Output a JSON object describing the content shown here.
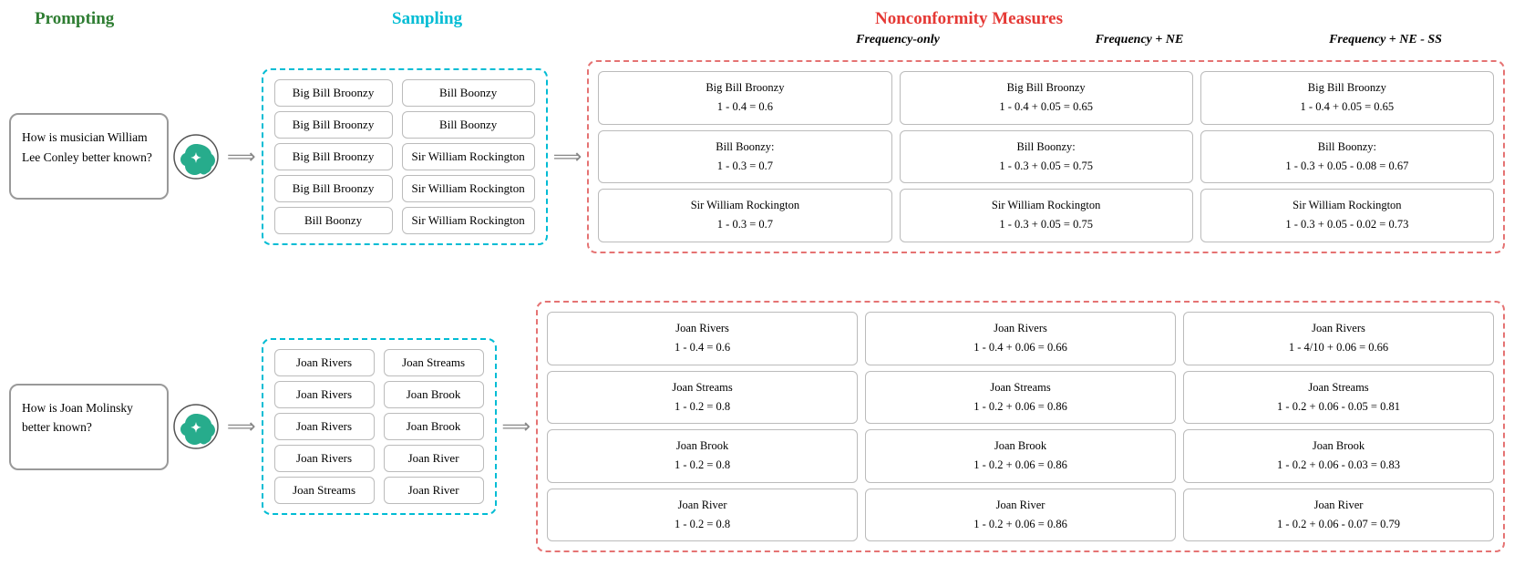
{
  "headers": {
    "prompting": "Prompting",
    "sampling": "Sampling",
    "nonconformity": "Nonconformity Measures",
    "freq_only": "Frequency-only",
    "freq_ne": "Frequency + NE",
    "freq_ne_ss": "Frequency + NE - SS"
  },
  "rows": [
    {
      "prompt": "How is musician William Lee Conley better known?",
      "samples_left": [
        "Big Bill Broonzy",
        "Big Bill Broonzy",
        "Big Bill Broonzy",
        "Big Bill Broonzy",
        "Bill Boonzy"
      ],
      "samples_right": [
        "Bill Boonzy",
        "Bill Boonzy",
        "Sir William Rockington",
        "Sir William Rockington",
        "Sir William Rockington"
      ],
      "nc_freq": [
        {
          "name": "Big Bill Broonzy",
          "formula": "1 - 0.4 = 0.6"
        },
        {
          "name": "Bill Boonzy:",
          "formula": "1 - 0.3 = 0.7"
        },
        {
          "name": "Sir William Rockington",
          "formula": "1 - 0.3 = 0.7"
        }
      ],
      "nc_freq_ne": [
        {
          "name": "Big Bill Broonzy",
          "formula": "1 - 0.4 + 0.05 = 0.65"
        },
        {
          "name": "Bill Boonzy:",
          "formula": "1 - 0.3 + 0.05 = 0.75"
        },
        {
          "name": "Sir William Rockington",
          "formula": "1 - 0.3 + 0.05 = 0.75"
        }
      ],
      "nc_freq_ne_ss": [
        {
          "name": "Big Bill Broonzy",
          "formula": "1 - 0.4 + 0.05 = 0.65"
        },
        {
          "name": "Bill Boonzy:",
          "formula": "1 - 0.3 + 0.05 - 0.08 = 0.67"
        },
        {
          "name": "Sir William Rockington",
          "formula": "1 - 0.3 + 0.05 - 0.02 = 0.73"
        }
      ]
    },
    {
      "prompt": "How is Joan Molinsky better known?",
      "samples_left": [
        "Joan Rivers",
        "Joan Rivers",
        "Joan Rivers",
        "Joan Rivers",
        "Joan Streams"
      ],
      "samples_right": [
        "Joan Streams",
        "Joan Brook",
        "Joan Brook",
        "Joan River",
        "Joan River"
      ],
      "nc_freq": [
        {
          "name": "Joan Rivers",
          "formula": "1 - 0.4 = 0.6"
        },
        {
          "name": "Joan Streams",
          "formula": "1 - 0.2 = 0.8"
        },
        {
          "name": "Joan Brook",
          "formula": "1 - 0.2 = 0.8"
        },
        {
          "name": "Joan River",
          "formula": "1 - 0.2 = 0.8"
        }
      ],
      "nc_freq_ne": [
        {
          "name": "Joan Rivers",
          "formula": "1 - 0.4 + 0.06 = 0.66"
        },
        {
          "name": "Joan Streams",
          "formula": "1 - 0.2 + 0.06 = 0.86"
        },
        {
          "name": "Joan Brook",
          "formula": "1 - 0.2 + 0.06 = 0.86"
        },
        {
          "name": "Joan River",
          "formula": "1 - 0.2 + 0.06 = 0.86"
        }
      ],
      "nc_freq_ne_ss": [
        {
          "name": "Joan Rivers",
          "formula": "1 - 4/10 + 0.06 = 0.66"
        },
        {
          "name": "Joan Streams",
          "formula": "1 - 0.2 + 0.06 - 0.05 = 0.81"
        },
        {
          "name": "Joan Brook",
          "formula": "1 - 0.2 + 0.06 - 0.03 = 0.83"
        },
        {
          "name": "Joan River",
          "formula": "1 - 0.2 + 0.06 - 0.07 = 0.79"
        }
      ]
    }
  ]
}
